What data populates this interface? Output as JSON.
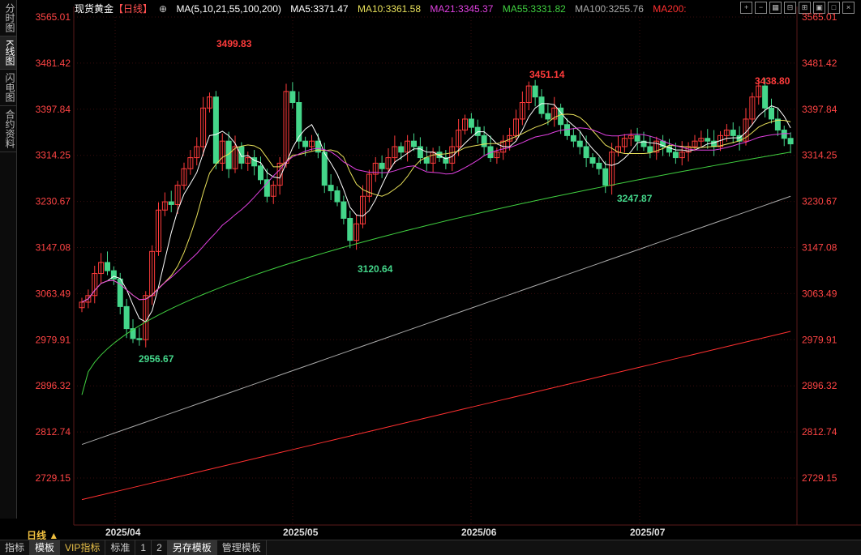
{
  "left_tabs": [
    "分时图",
    "K线图",
    "闪电图",
    "合约资料"
  ],
  "legend": {
    "symbol": "现货黄金",
    "period": "【日线】",
    "ma_params": "MA(5,10,21,55,100,200)",
    "ma5": "MA5:3371.47",
    "ma10": "MA10:3361.58",
    "ma21": "MA21:3345.37",
    "ma55": "MA55:3331.82",
    "ma100": "MA100:3255.76",
    "ma200": "MA200:"
  },
  "colors": {
    "up": "#ff3b3b",
    "down": "#44d68a",
    "ma5": "#ffffff",
    "ma10": "#e8e05a",
    "ma21": "#e040e0",
    "ma55": "#40d040",
    "ma100": "#aaaaaa",
    "ma200": "#ff3030",
    "axis": "#ff4444"
  },
  "y_axis": {
    "ticks": [
      "3565.01",
      "3481.42",
      "3397.84",
      "3314.25",
      "3230.67",
      "3147.08",
      "3063.49",
      "2979.91",
      "2896.32",
      "2812.74",
      "2729.15"
    ],
    "min": 2729.15,
    "max": 3565.01
  },
  "x_axis": {
    "labels": [
      "2025/04",
      "2025/05",
      "2025/06",
      "2025/07"
    ]
  },
  "annotations": {
    "high_apr": "3499.83",
    "low_apr": "2956.67",
    "low_may": "3120.64",
    "high_jun": "3451.14",
    "low_jun": "3247.87",
    "high_jul": "3438.80"
  },
  "period_label": "日线 ▲",
  "bottom_tabs": [
    "指标",
    "模板",
    "VIP指标",
    "标准",
    "1",
    "2",
    "另存模板",
    "管理模板"
  ],
  "toolbar_icons": [
    "plus-icon",
    "minus-icon",
    "grid-icon",
    "collapse-icon",
    "expand-icon",
    "box-icon",
    "window-icon",
    "close-icon"
  ]
}
